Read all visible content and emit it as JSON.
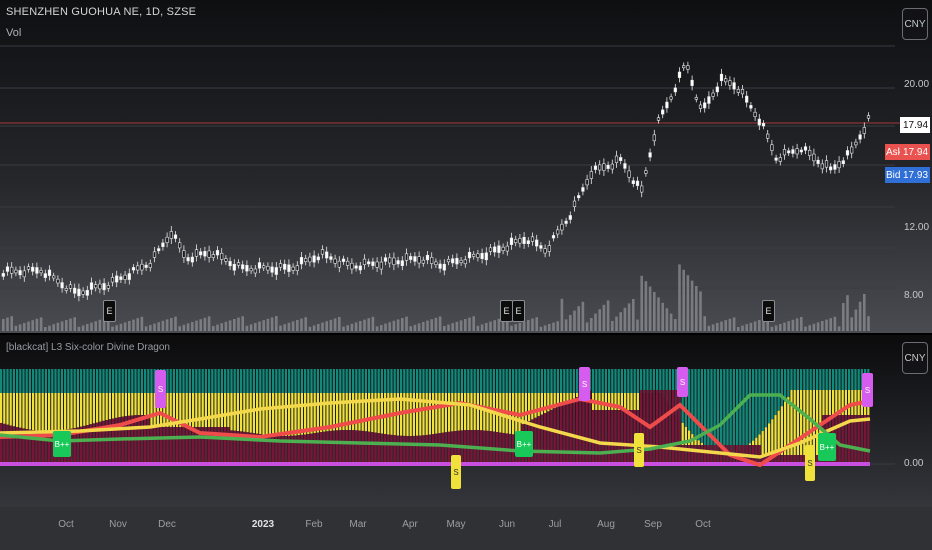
{
  "header": {
    "symbol_title": "SHENZHEN GUOHUA NE, 1D, SZSE",
    "volume_label": "Vol"
  },
  "currency": {
    "top": "CNY",
    "bottom": "CNY"
  },
  "price_axis": {
    "ticks": [
      "20.00",
      "12.00",
      "8.00"
    ],
    "last_price": "17.94",
    "ask_label": "Ask",
    "ask_value": "17.94",
    "bid_label": "Bid",
    "bid_value": "17.93"
  },
  "earnings_badges": [
    "E",
    "E",
    "E",
    "E"
  ],
  "indicator": {
    "name": "[blackcat] L3 Six-color Divine Dragon",
    "axis_tick": "0.00",
    "signals": [
      "S",
      "S",
      "S",
      "S",
      "B++",
      "B++",
      "B++",
      "S",
      "S",
      "S"
    ]
  },
  "time_axis": [
    "Oct",
    "Nov",
    "Dec",
    "2023",
    "Feb",
    "Mar",
    "Apr",
    "May",
    "Jun",
    "Jul",
    "Aug",
    "Sep",
    "Oct"
  ],
  "colors": {
    "up": "#ffffff",
    "teal": "#0f8a7b",
    "yellow": "#f0e23a",
    "maroon": "#7a1538",
    "red_line": "#ef4b4b",
    "yellow_line": "#f2d84a",
    "green_line": "#4caf50",
    "magenta": "#d65cf0",
    "ask": "#e9524f",
    "bid": "#2f6fd6"
  }
}
